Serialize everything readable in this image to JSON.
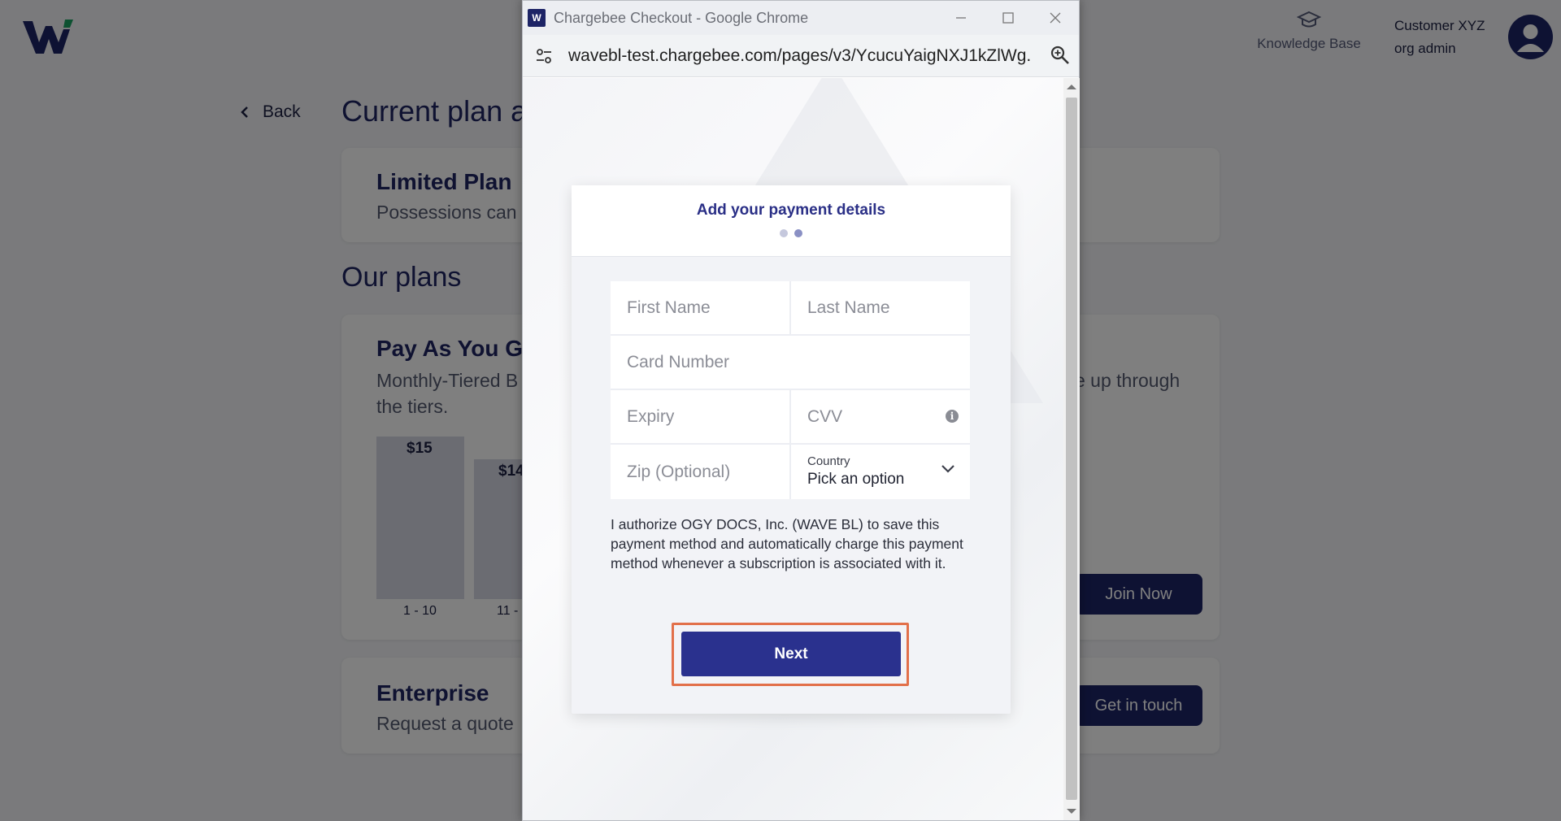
{
  "app": {
    "knowledge_base": "Knowledge Base",
    "user_name": "Customer XYZ",
    "user_role": "org admin",
    "back_label": "Back",
    "page_title": "Current plan a",
    "current_plan": {
      "name": "Limited Plan",
      "desc": "Possessions can b"
    },
    "our_plans_title": "Our plans",
    "payg": {
      "name": "Pay As You G",
      "desc_line1": "Monthly-Tiered B",
      "desc_line2": "the tiers.",
      "desc_right": "e up through",
      "bars": [
        {
          "value": "$15",
          "label": "1 - 10",
          "level": 1.0
        },
        {
          "value": "$14",
          "label": "11 -",
          "level": 0.86
        }
      ],
      "join_label": "Join Now"
    },
    "enterprise": {
      "name": "Enterprise",
      "desc": "Request a quote",
      "cta": "Get in touch"
    }
  },
  "popup": {
    "window_title": "Chargebee Checkout - Google Chrome",
    "favicon_letter": "W",
    "url": "wavebl-test.chargebee.com/pages/v3/YcucuYaigNXJ1kZlWg...",
    "form": {
      "title": "Add your payment details",
      "first_name_placeholder": "First Name",
      "last_name_placeholder": "Last Name",
      "card_number_placeholder": "Card Number",
      "expiry_placeholder": "Expiry",
      "cvv_placeholder": "CVV",
      "zip_placeholder": "Zip (Optional)",
      "country_label": "Country",
      "country_value": "Pick an option",
      "authorize_text": "I authorize OGY DOCS, Inc. (WAVE BL) to save this payment method and automatically charge this payment method whenever a subscription is associated with it.",
      "next_label": "Next",
      "step": 2,
      "total_steps": 2
    }
  },
  "colors": {
    "brand_navy": "#1d2466",
    "button_blue": "#2a318e",
    "logo_green": "#1aa363",
    "highlight": "#e2704a"
  }
}
